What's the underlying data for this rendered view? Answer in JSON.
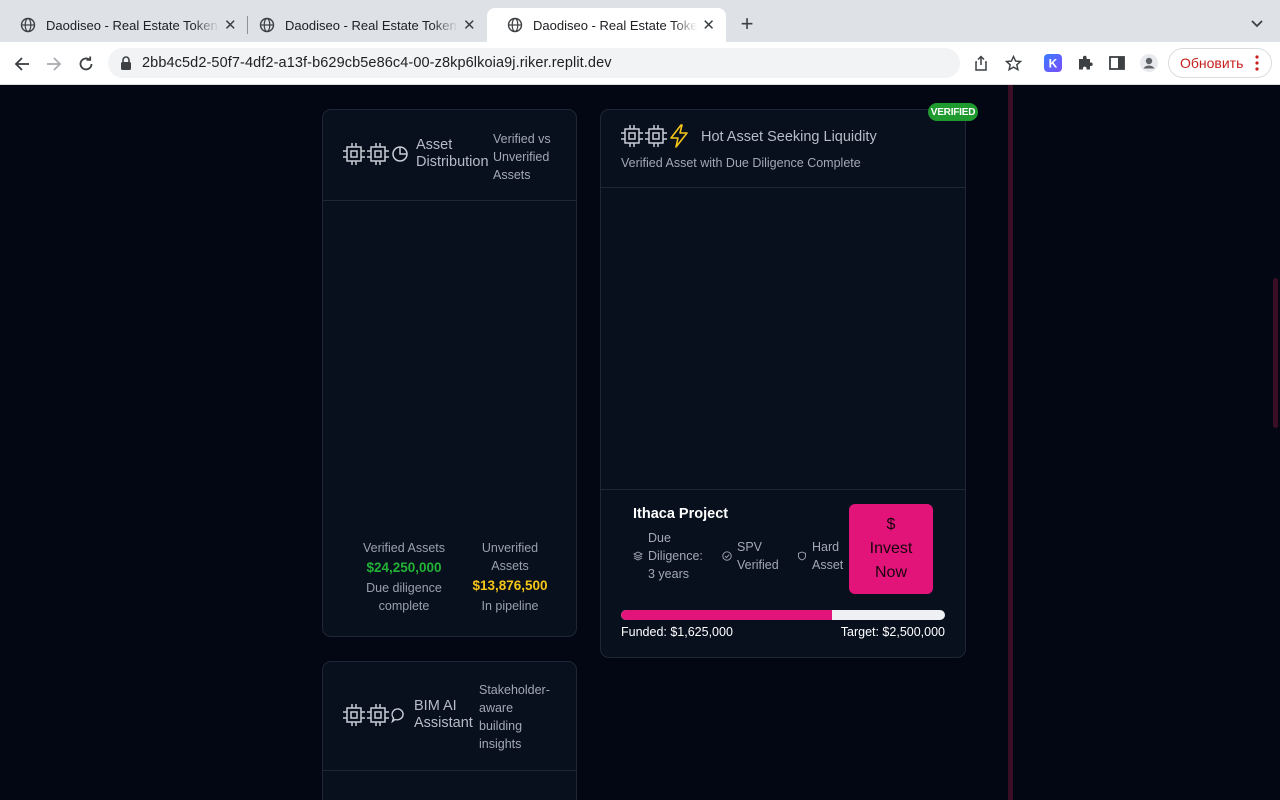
{
  "browser": {
    "tabs": [
      {
        "title": "Daodiseo - Real Estate Tokeniz",
        "active": false
      },
      {
        "title": "Daodiseo - Real Estate Tokeniz",
        "active": false
      },
      {
        "title": "Daodiseo - Real Estate Tokeniz",
        "active": true
      }
    ],
    "url": "2bb4c5d2-50f7-4df2-a13f-b629cb5e86c4-00-z8kp6lkoia9j.riker.replit.dev",
    "update_label": "Обновить",
    "extension_letter": "K"
  },
  "asset_distribution": {
    "title_line1": "Asset",
    "title_line2": "Distribution",
    "subtitle_line1": "Verified vs",
    "subtitle_line2": "Unverified",
    "subtitle_line3": "Assets",
    "verified": {
      "label": "Verified Assets",
      "value": "$24,250,000",
      "note_line1": "Due diligence",
      "note_line2": "complete",
      "color": "#22b336"
    },
    "unverified": {
      "label_line1": "Unverified",
      "label_line2": "Assets",
      "value": "$13,876,500",
      "note": "In pipeline",
      "color": "#f5c518"
    }
  },
  "hot_asset": {
    "badge": "VERIFIED",
    "title": "Hot Asset Seeking Liquidity",
    "subtitle": "Verified Asset with Due Diligence Complete",
    "project_name": "Ithaca Project",
    "features": [
      {
        "icon": "layers-icon",
        "lines": [
          "Due",
          "Diligence:",
          "3 years"
        ]
      },
      {
        "icon": "check-circle-icon",
        "lines": [
          "SPV",
          "Verified"
        ]
      },
      {
        "icon": "shield-icon",
        "lines": [
          "Hard",
          "Asset"
        ]
      }
    ],
    "invest_lines": [
      "$",
      "Invest",
      "Now"
    ],
    "funded_label": "Funded: $1,625,000",
    "target_label": "Target: $2,500,000",
    "funded_fraction": 0.65,
    "accent_color": "#e2147a"
  },
  "bim_assistant": {
    "title_line1": "BIM AI",
    "title_line2": "Assistant",
    "subtitle_lines": [
      "Stakeholder-",
      "aware",
      "building",
      "insights"
    ]
  }
}
